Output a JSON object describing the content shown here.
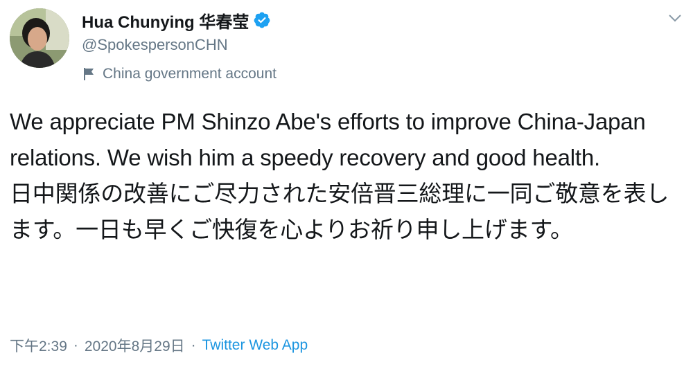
{
  "tweet": {
    "author": {
      "display_name": "Hua Chunying 华春莹",
      "handle": "@SpokespersonCHN",
      "label": "China government account",
      "verified": true
    },
    "text_en": "We appreciate PM Shinzo Abe's efforts to improve China-Japan relations. We wish him a speedy recovery and good health.",
    "text_ja": "日中関係の改善にご尽力された安倍晋三総理に一同ご敬意を表します。一日も早くご快復を心よりお祈り申し上げます。",
    "time": "下午2:39",
    "separator": "·",
    "date": "2020年8月29日",
    "source": "Twitter Web App"
  },
  "colors": {
    "verified_blue": "#1da1f2",
    "secondary_text": "#657786",
    "link_blue": "#1b95e0"
  },
  "icons": [
    "verified-badge-icon",
    "government-flag-icon",
    "chevron-down-icon"
  ]
}
